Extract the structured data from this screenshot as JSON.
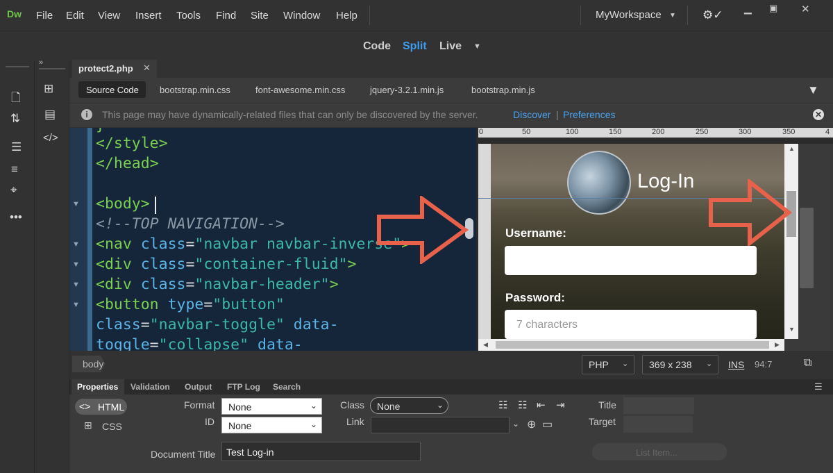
{
  "app": {
    "logo": "Dw"
  },
  "menu": {
    "items": [
      "File",
      "Edit",
      "View",
      "Insert",
      "Tools",
      "Find",
      "Site",
      "Window",
      "Help"
    ]
  },
  "workspace": {
    "label": "MyWorkspace"
  },
  "view_modes": {
    "code": "Code",
    "split": "Split",
    "live": "Live",
    "active": "Split"
  },
  "document": {
    "tab": "protect2.php"
  },
  "related_files": [
    "Source Code",
    "bootstrap.min.css",
    "font-awesome.min.css",
    "jquery-3.2.1.min.js",
    "bootstrap.min.js"
  ],
  "info_bar": {
    "message": "This page may have dynamically-related files that can only be discovered by the server.",
    "discover": "Discover",
    "separator": "|",
    "preferences": "Preferences"
  },
  "code_lines": [
    {
      "tag": "</style>"
    },
    {
      "tag": "</head>"
    },
    {
      "tag": ""
    },
    {
      "tag": "<body>"
    },
    {
      "comment": "<!--TOP NAVIGATION-->"
    },
    {
      "open": "<nav ",
      "attr": "class",
      "eq": "=",
      "val": "\"navbar navbar-inverse\"",
      "close": ">"
    },
    {
      "open": "<div ",
      "attr": "class",
      "eq": "=",
      "val": "\"container-fluid\"",
      "close": ">"
    },
    {
      "open": "<div ",
      "attr": "class",
      "eq": "=",
      "val": "\"navbar-header\"",
      "close": ">"
    },
    {
      "open": "<button ",
      "attr": "type",
      "eq": "=",
      "val": "\"button\"",
      "close": ""
    },
    {
      "open": "",
      "attr": "class",
      "eq": "=",
      "val": "\"navbar-toggle\"",
      "tail": " data-"
    },
    {
      "open": "",
      "attr": "toggle",
      "eq": "=",
      "val": "\"collapse\"",
      "tail": " data-"
    }
  ],
  "live_view": {
    "heading": "Log-In",
    "username_label": "Username:",
    "password_label": "Password:",
    "password_placeholder": "7 characters"
  },
  "ruler_ticks": [
    "0",
    "50",
    "100",
    "150",
    "200",
    "250",
    "300",
    "350",
    "4"
  ],
  "status_bar": {
    "tag": "body",
    "doc_type": "PHP",
    "window_size": "369 x 238",
    "ins": "INS",
    "cursor": "94:7"
  },
  "panel_tabs": [
    "Properties",
    "Validation",
    "Output",
    "FTP Log",
    "Search"
  ],
  "properties": {
    "html_btn": "HTML",
    "css_btn": "CSS",
    "format_label": "Format",
    "format_value": "None",
    "id_label": "ID",
    "id_value": "None",
    "class_label": "Class",
    "class_value": "None",
    "link_label": "Link",
    "title_label": "Title",
    "target_label": "Target",
    "doc_title_label": "Document Title",
    "doc_title_value": "Test Log-in",
    "list_item": "List Item..."
  },
  "colors": {
    "accent": "#3d9cf0",
    "code_bg": "#15253a",
    "arrow": "#e8614a"
  }
}
